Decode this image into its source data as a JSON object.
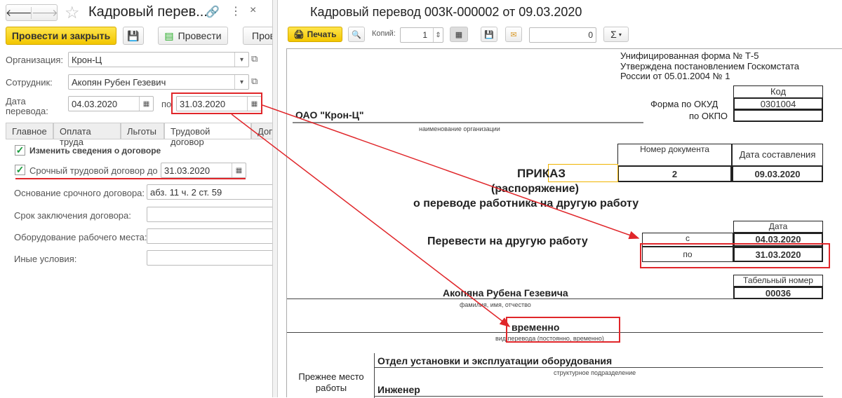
{
  "form": {
    "title": "Кадровый перев...",
    "buttons": {
      "post_close": "Провести и закрыть",
      "post": "Провести",
      "more": "Пров"
    },
    "org_label": "Организация:",
    "org_value": "Крон-Ц",
    "emp_label": "Сотрудник:",
    "emp_value": "Акопян Рубен Гезевич",
    "date_label1": "Дата",
    "date_label2": "перевода:",
    "date_from": "04.03.2020",
    "date_to_label": "по",
    "date_to": "31.03.2020",
    "tabs": [
      "Главное",
      "Оплата труда",
      "Льготы",
      "Трудовой договор",
      "Доп"
    ],
    "change_contract": "Изменить сведения о договоре",
    "fixed_term": "Срочный трудовой договор до",
    "fixed_term_date": "31.03.2020",
    "basis_label": "Основание срочного договора:",
    "basis_value": "абз. 11 ч. 2 ст. 59",
    "term_label": "Срок заключения договора:",
    "equip_label": "Оборудование рабочего места:",
    "other_label": "Иные условия:"
  },
  "print": {
    "title": "Кадровый перевод 003К-000002 от 09.03.2020",
    "print_btn": "Печать",
    "copies_label": "Копий:",
    "copies": "1",
    "num": "0",
    "sum": "Σ"
  },
  "doc": {
    "unified1": "Унифицированная форма № Т-5",
    "unified2": "Утверждена постановлением Госкомстата",
    "unified3": "России от 05.01.2004 № 1",
    "code": "Код",
    "okud_label": "Форма по ОКУД",
    "okud": "0301004",
    "okpo_label": "по ОКПО",
    "org": "ОАО \"Крон-Ц\"",
    "org_caption": "наименование организации",
    "docnum_h": "Номер документа",
    "date_h": "Дата составления",
    "docnum": "2",
    "docdate": "09.03.2020",
    "order1": "ПРИКАЗ",
    "order2": "(распоряжение)",
    "order3": "о переводе работника на другую работу",
    "transfer": "Перевести на другую работу",
    "date_col": "Дата",
    "from_lbl": "с",
    "from": "04.03.2020",
    "to_lbl": "по",
    "to": "31.03.2020",
    "tab_h": "Табельный номер",
    "tab_no": "00036",
    "name": "Акопяна Рубена Гезевича",
    "name_caption": "фамилия, имя, отчество",
    "kind": "временно",
    "kind_caption": "вид перевода (постоянно, временно)",
    "prev_place": "Прежнее место работы",
    "dept": "Отдел установки и эксплуатации оборудования",
    "dept_caption": "структурное подразделение",
    "position": "Инженер"
  }
}
